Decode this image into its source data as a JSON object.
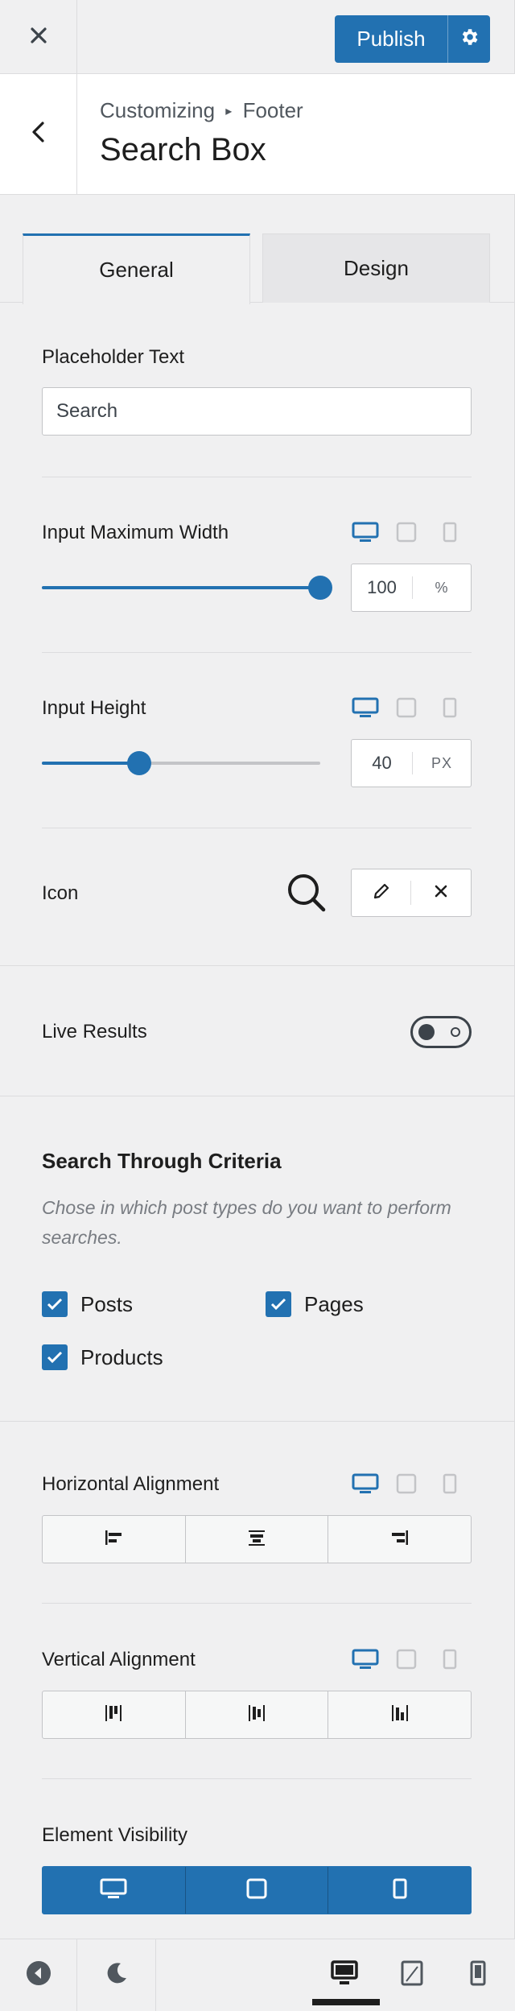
{
  "header": {
    "publish_label": "Publish",
    "close_icon": "close-icon",
    "settings_icon": "gear-icon"
  },
  "titlebar": {
    "breadcrumb_root": "Customizing",
    "breadcrumb_sep": "▸",
    "breadcrumb_section": "Footer",
    "title": "Search Box"
  },
  "tabs": [
    {
      "label": "General",
      "active": true
    },
    {
      "label": "Design",
      "active": false
    }
  ],
  "placeholder": {
    "label": "Placeholder Text",
    "value": "Search"
  },
  "input_max_width": {
    "label": "Input Maximum Width",
    "value": "100",
    "unit": "%",
    "slider_fraction": 1.0
  },
  "input_height": {
    "label": "Input Height",
    "value": "40",
    "unit": "PX",
    "slider_fraction": 0.35
  },
  "icon": {
    "label": "Icon",
    "icon": "search-icon"
  },
  "live_results": {
    "label": "Live Results",
    "enabled": false
  },
  "criteria": {
    "title": "Search Through Criteria",
    "help": "Chose in which post types do you want to perform searches.",
    "options": [
      {
        "label": "Posts",
        "checked": true
      },
      {
        "label": "Pages",
        "checked": true
      },
      {
        "label": "Products",
        "checked": true
      }
    ]
  },
  "horizontal_alignment": {
    "label": "Horizontal Alignment",
    "options": [
      "align-left-icon",
      "align-center-icon",
      "align-right-icon"
    ]
  },
  "vertical_alignment": {
    "label": "Vertical Alignment",
    "options": [
      "align-top-icon",
      "align-middle-icon",
      "align-bottom-icon"
    ]
  },
  "element_visibility": {
    "label": "Element Visibility",
    "options": [
      "desktop-icon",
      "tablet-icon",
      "mobile-icon"
    ]
  },
  "footer": {
    "hide_controls_icon": "collapse-icon",
    "theme_icon": "moon-icon",
    "preview_devices": [
      "desktop-icon",
      "tablet-icon",
      "mobile-icon"
    ],
    "active_device": "desktop"
  },
  "colors": {
    "accent": "#2271b1",
    "panel_bg": "#f0f0f1",
    "border": "#dcdcde",
    "text": "#1e1e1e",
    "muted": "#787c82"
  }
}
